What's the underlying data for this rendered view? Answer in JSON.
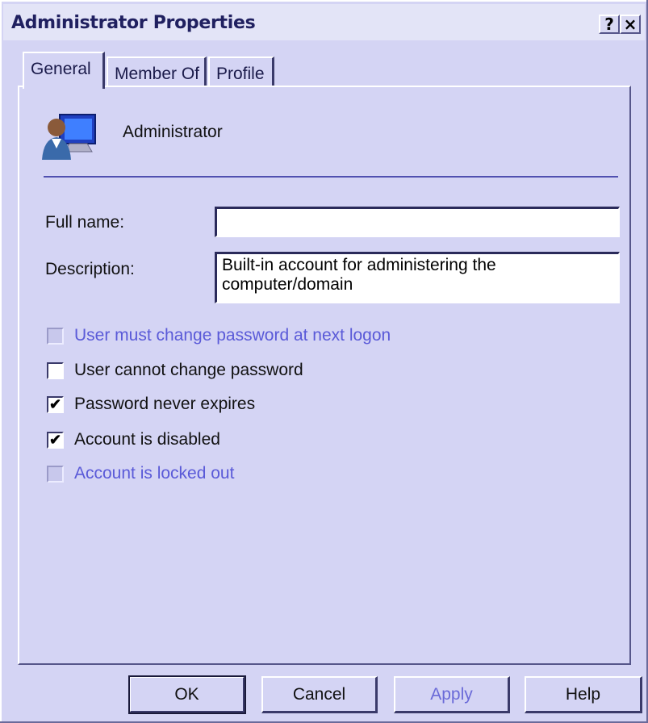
{
  "window": {
    "title": "Administrator Properties",
    "help_glyph": "?",
    "close_glyph": "×"
  },
  "tabs": [
    {
      "label": "General",
      "active": true
    },
    {
      "label": "Member Of",
      "active": false
    },
    {
      "label": "Profile",
      "active": false
    }
  ],
  "general": {
    "user_icon": "user-computer-icon",
    "user_name": "Administrator",
    "full_name": {
      "label": "Full name:",
      "value": ""
    },
    "description": {
      "label": "Description:",
      "value": "Built-in account for administering the computer/domain"
    },
    "checkboxes": [
      {
        "label": "User must change password at next logon",
        "checked": false,
        "enabled": false
      },
      {
        "label": "User cannot change password",
        "checked": false,
        "enabled": true
      },
      {
        "label": "Password never expires",
        "checked": true,
        "enabled": true
      },
      {
        "label": "Account is disabled",
        "checked": true,
        "enabled": true
      },
      {
        "label": "Account is locked out",
        "checked": false,
        "enabled": false
      }
    ]
  },
  "buttons": {
    "ok": "OK",
    "cancel": "Cancel",
    "apply": "Apply",
    "help": "Help"
  },
  "colors": {
    "background": "#d4d4f4",
    "disabled_text": "#5a5ad8",
    "separator": "#5050b0"
  }
}
